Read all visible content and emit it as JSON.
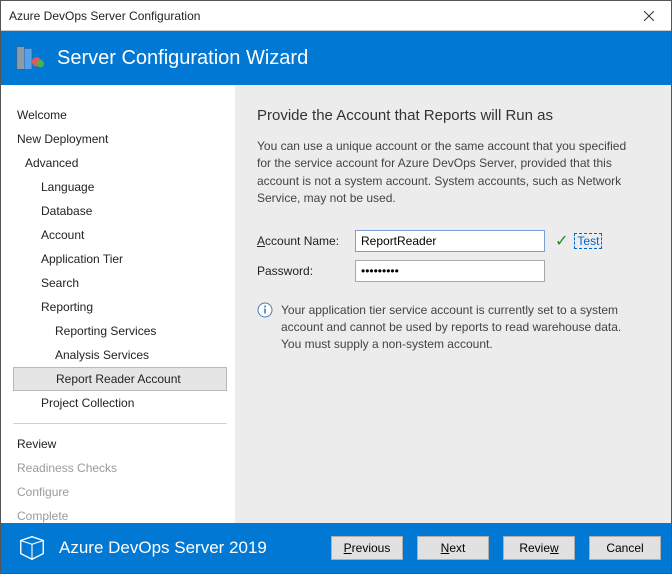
{
  "window": {
    "title": "Azure DevOps Server Configuration"
  },
  "banner": {
    "title": "Server Configuration Wizard"
  },
  "sidebar": {
    "items": [
      {
        "label": "Welcome",
        "level": 0
      },
      {
        "label": "New Deployment",
        "level": 0
      },
      {
        "label": "Advanced",
        "level": 1
      },
      {
        "label": "Language",
        "level": 2
      },
      {
        "label": "Database",
        "level": 2
      },
      {
        "label": "Account",
        "level": 2
      },
      {
        "label": "Application Tier",
        "level": 2
      },
      {
        "label": "Search",
        "level": 2
      },
      {
        "label": "Reporting",
        "level": 2
      },
      {
        "label": "Reporting Services",
        "level": 3
      },
      {
        "label": "Analysis Services",
        "level": 3
      },
      {
        "label": "Report Reader Account",
        "level": 3,
        "selected": true
      },
      {
        "label": "Project Collection",
        "level": 2
      }
    ],
    "bottom": [
      {
        "label": "Review"
      },
      {
        "label": "Readiness Checks",
        "disabled": true
      },
      {
        "label": "Configure",
        "disabled": true
      },
      {
        "label": "Complete",
        "disabled": true
      }
    ]
  },
  "main": {
    "heading": "Provide the Account that Reports will Run as",
    "desc": "You can use a unique account or the same account that you specified for the service account for Azure DevOps Server, provided that this account is not a system account. System accounts, such as Network Service, may not be used.",
    "account_label_pre": "A",
    "account_label_rest": "ccount Name:",
    "account_value": "ReportReader",
    "password_label": "Password:",
    "password_value": "•••••••••",
    "test_label": "Test",
    "info": "Your application tier service account is currently set to a system account and cannot be used by reports to read warehouse data. You must supply a non-system account."
  },
  "footer": {
    "product": "Azure DevOps Server 2019",
    "previous": "revious",
    "previous_u": "P",
    "next": "ext",
    "next_u": "N",
    "review": "Revie",
    "review_u": "w",
    "cancel": "Cancel"
  }
}
